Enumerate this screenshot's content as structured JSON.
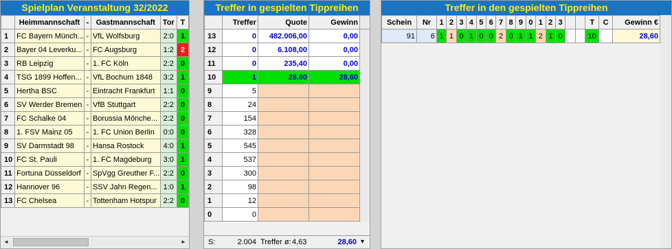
{
  "panel1": {
    "title": "Spielplan Veranstaltung 32/2022",
    "headers": {
      "home": "Heimmannschaft",
      "sep": "-",
      "away": "Gastmannschaft",
      "score": "Tor",
      "tip": "T"
    },
    "rows": [
      {
        "nr": "1",
        "home": "FC Bayern Münch...",
        "sep": "-",
        "away": "VfL Wolfsburg",
        "score": "2:0",
        "tip": "1",
        "tip_color": "green"
      },
      {
        "nr": "2",
        "home": "Bayer 04 Leverku...",
        "sep": "-",
        "away": "FC Augsburg",
        "score": "1:2",
        "tip": "2",
        "tip_color": "red"
      },
      {
        "nr": "3",
        "home": "RB Leipzig",
        "sep": "-",
        "away": "1. FC Köln",
        "score": "2:2",
        "tip": "0",
        "tip_color": "green"
      },
      {
        "nr": "4",
        "home": "TSG 1899 Hoffen...",
        "sep": "-",
        "away": "VfL Bochum 1848",
        "score": "3:2",
        "tip": "1",
        "tip_color": "green"
      },
      {
        "nr": "5",
        "home": "Hertha BSC",
        "sep": "-",
        "away": "Eintracht Frankfurt",
        "score": "1:1",
        "tip": "0",
        "tip_color": "green"
      },
      {
        "nr": "6",
        "home": "SV Werder Bremen",
        "sep": "-",
        "away": "VfB Stuttgart",
        "score": "2:2",
        "tip": "0",
        "tip_color": "green"
      },
      {
        "nr": "7",
        "home": "FC Schalke 04",
        "sep": "-",
        "away": "Borussia Mönche...",
        "score": "2:2",
        "tip": "0",
        "tip_color": "green"
      },
      {
        "nr": "8",
        "home": "1. FSV Mainz 05",
        "sep": "-",
        "away": "1. FC Union Berlin",
        "score": "0:0",
        "tip": "0",
        "tip_color": "green"
      },
      {
        "nr": "9",
        "home": "SV Darmstadt 98",
        "sep": "-",
        "away": "Hansa Rostock",
        "score": "4:0",
        "tip": "1",
        "tip_color": "green"
      },
      {
        "nr": "10",
        "home": "FC St. Pauli",
        "sep": "-",
        "away": "1. FC Magdeburg",
        "score": "3:0",
        "tip": "1",
        "tip_color": "green"
      },
      {
        "nr": "11",
        "home": "Fortuna Düsseldorf",
        "sep": "-",
        "away": "SpVgg Greuther F...",
        "score": "2:2",
        "tip": "0",
        "tip_color": "green"
      },
      {
        "nr": "12",
        "home": "Hannover 96",
        "sep": "-",
        "away": "SSV Jahn Regen...",
        "score": "1:0",
        "tip": "1",
        "tip_color": "green"
      },
      {
        "nr": "13",
        "home": "FC Chelsea",
        "sep": "-",
        "away": "Tottenham Hotspur",
        "score": "2:2",
        "tip": "0",
        "tip_color": "green"
      }
    ],
    "scroll_left": "◄",
    "scroll_right": "►"
  },
  "panel2": {
    "title": "Treffer in gespielten Tippreihen",
    "headers": {
      "treffer": "Treffer",
      "quote": "Quote",
      "gewinn": "Gewinn"
    },
    "rows": [
      {
        "nr": "13",
        "treffer": "0",
        "quote": "482.006,00",
        "gewinn": "0,00",
        "style": "white"
      },
      {
        "nr": "12",
        "treffer": "0",
        "quote": "6.108,00",
        "gewinn": "0,00",
        "style": "white"
      },
      {
        "nr": "11",
        "treffer": "0",
        "quote": "235,40",
        "gewinn": "0,00",
        "style": "white"
      },
      {
        "nr": "10",
        "treffer": "1",
        "quote": "28,60",
        "gewinn": "28,60",
        "style": "green"
      },
      {
        "nr": "9",
        "treffer": "5",
        "quote": "",
        "gewinn": "",
        "style": "peach"
      },
      {
        "nr": "8",
        "treffer": "24",
        "quote": "",
        "gewinn": "",
        "style": "peach"
      },
      {
        "nr": "7",
        "treffer": "154",
        "quote": "",
        "gewinn": "",
        "style": "peach"
      },
      {
        "nr": "6",
        "treffer": "328",
        "quote": "",
        "gewinn": "",
        "style": "peach"
      },
      {
        "nr": "5",
        "treffer": "545",
        "quote": "",
        "gewinn": "",
        "style": "peach"
      },
      {
        "nr": "4",
        "treffer": "537",
        "quote": "",
        "gewinn": "",
        "style": "peach"
      },
      {
        "nr": "3",
        "treffer": "300",
        "quote": "",
        "gewinn": "",
        "style": "peach"
      },
      {
        "nr": "2",
        "treffer": "98",
        "quote": "",
        "gewinn": "",
        "style": "peach"
      },
      {
        "nr": "1",
        "treffer": "12",
        "quote": "",
        "gewinn": "",
        "style": "peach"
      },
      {
        "nr": "0",
        "treffer": "0",
        "quote": "",
        "gewinn": "",
        "style": "peach"
      }
    ],
    "footer": {
      "s_label": "S:",
      "sum": "2.004",
      "avg_label": "Treffer ø:",
      "avg": "4,63",
      "total": "28,60",
      "dropdown": "▾"
    }
  },
  "panel3": {
    "title": "Treffer in den gespielten Tippreihen",
    "headers": {
      "schein": "Schein",
      "nr": "Nr",
      "games": [
        "1",
        "2",
        "3",
        "4",
        "5",
        "6",
        "7",
        "8",
        "9",
        "0",
        "1",
        "2",
        "3"
      ],
      "t": "T",
      "c": "C",
      "gewinn": "Gewinn €"
    },
    "row": {
      "schein": "91",
      "nr": "6",
      "tips": [
        {
          "v": "1",
          "c": "green"
        },
        {
          "v": "1",
          "c": "gray"
        },
        {
          "v": "0",
          "c": "green"
        },
        {
          "v": "1",
          "c": "green"
        },
        {
          "v": "0",
          "c": "green"
        },
        {
          "v": "0",
          "c": "green"
        },
        {
          "v": "2",
          "c": "gray"
        },
        {
          "v": "0",
          "c": "green"
        },
        {
          "v": "1",
          "c": "green"
        },
        {
          "v": "1",
          "c": "green"
        },
        {
          "v": "2",
          "c": "gray"
        },
        {
          "v": "1",
          "c": "green"
        },
        {
          "v": "0",
          "c": "green"
        }
      ],
      "t": "10",
      "c": "",
      "gewinn": "28,60"
    }
  }
}
